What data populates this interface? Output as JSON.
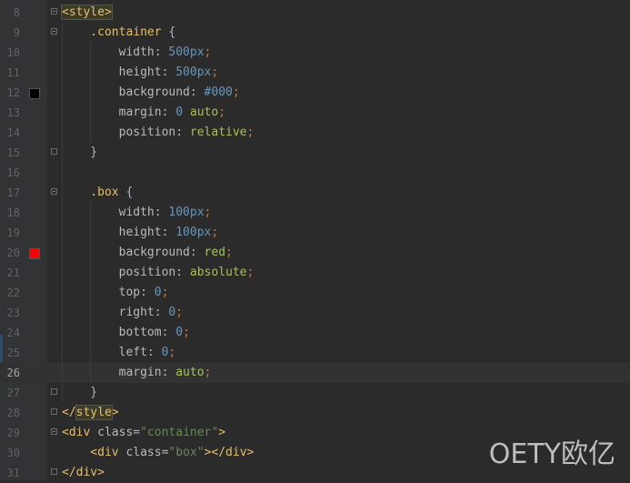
{
  "editor": {
    "lines": [
      {
        "n": "8",
        "tokens": [
          [
            "tag-hl",
            "<style>"
          ]
        ]
      },
      {
        "n": "9",
        "tokens": [
          [
            "sel",
            "    .container"
          ],
          [
            "brace",
            " {"
          ]
        ]
      },
      {
        "n": "10",
        "tokens": [
          [
            "prop",
            "        width"
          ],
          [
            "val",
            ": "
          ],
          [
            "num",
            "500px"
          ],
          [
            "punc",
            ";"
          ]
        ]
      },
      {
        "n": "11",
        "tokens": [
          [
            "prop",
            "        height"
          ],
          [
            "val",
            ": "
          ],
          [
            "num",
            "500px"
          ],
          [
            "punc",
            ";"
          ]
        ]
      },
      {
        "n": "12",
        "tokens": [
          [
            "prop",
            "        background"
          ],
          [
            "val",
            ": "
          ],
          [
            "num",
            "#000"
          ],
          [
            "punc",
            ";"
          ]
        ],
        "swatch": "#000000"
      },
      {
        "n": "13",
        "tokens": [
          [
            "prop",
            "        margin"
          ],
          [
            "val",
            ": "
          ],
          [
            "num",
            "0"
          ],
          [
            "val",
            " "
          ],
          [
            "kw",
            "auto"
          ],
          [
            "punc",
            ";"
          ]
        ]
      },
      {
        "n": "14",
        "tokens": [
          [
            "prop",
            "        position"
          ],
          [
            "val",
            ": "
          ],
          [
            "kw",
            "relative"
          ],
          [
            "punc",
            ";"
          ]
        ]
      },
      {
        "n": "15",
        "tokens": [
          [
            "brace",
            "    }"
          ]
        ]
      },
      {
        "n": "16",
        "tokens": []
      },
      {
        "n": "17",
        "tokens": [
          [
            "sel",
            "    .box"
          ],
          [
            "brace",
            " {"
          ]
        ]
      },
      {
        "n": "18",
        "tokens": [
          [
            "prop",
            "        width"
          ],
          [
            "val",
            ": "
          ],
          [
            "num",
            "100px"
          ],
          [
            "punc",
            ";"
          ]
        ]
      },
      {
        "n": "19",
        "tokens": [
          [
            "prop",
            "        height"
          ],
          [
            "val",
            ": "
          ],
          [
            "num",
            "100px"
          ],
          [
            "punc",
            ";"
          ]
        ]
      },
      {
        "n": "20",
        "tokens": [
          [
            "prop",
            "        background"
          ],
          [
            "val",
            ": "
          ],
          [
            "kw",
            "red"
          ],
          [
            "punc",
            ";"
          ]
        ],
        "swatch": "#ff0000"
      },
      {
        "n": "21",
        "tokens": [
          [
            "prop",
            "        position"
          ],
          [
            "val",
            ": "
          ],
          [
            "kw",
            "absolute"
          ],
          [
            "punc",
            ";"
          ]
        ]
      },
      {
        "n": "22",
        "tokens": [
          [
            "prop",
            "        top"
          ],
          [
            "val",
            ": "
          ],
          [
            "num",
            "0"
          ],
          [
            "punc",
            ";"
          ]
        ]
      },
      {
        "n": "23",
        "tokens": [
          [
            "prop",
            "        right"
          ],
          [
            "val",
            ": "
          ],
          [
            "num",
            "0"
          ],
          [
            "punc",
            ";"
          ]
        ]
      },
      {
        "n": "24",
        "tokens": [
          [
            "prop",
            "        bottom"
          ],
          [
            "val",
            ": "
          ],
          [
            "num",
            "0"
          ],
          [
            "punc",
            ";"
          ]
        ]
      },
      {
        "n": "25",
        "tokens": [
          [
            "prop",
            "        left"
          ],
          [
            "val",
            ": "
          ],
          [
            "num",
            "0"
          ],
          [
            "punc",
            ";"
          ]
        ]
      },
      {
        "n": "26",
        "tokens": [
          [
            "prop",
            "        margin"
          ],
          [
            "val",
            ": "
          ],
          [
            "kw",
            "auto"
          ],
          [
            "punc",
            ";"
          ]
        ],
        "current": true
      },
      {
        "n": "27",
        "tokens": [
          [
            "brace",
            "    }"
          ]
        ]
      },
      {
        "n": "28",
        "tokens": [
          [
            "tag",
            "</"
          ],
          [
            "tag-hl",
            "style"
          ],
          [
            "tag",
            ">"
          ]
        ]
      },
      {
        "n": "29",
        "tokens": [
          [
            "tag",
            "<div"
          ],
          [
            "attr",
            " class"
          ],
          [
            "val",
            "="
          ],
          [
            "str",
            "\"container\""
          ],
          [
            "tag",
            ">"
          ]
        ]
      },
      {
        "n": "30",
        "tokens": [
          [
            "tag",
            "    <div"
          ],
          [
            "attr",
            " class"
          ],
          [
            "val",
            "="
          ],
          [
            "str",
            "\"box\""
          ],
          [
            "tag",
            "></div>"
          ]
        ]
      },
      {
        "n": "31",
        "tokens": [
          [
            "tag",
            "</div>"
          ]
        ]
      }
    ],
    "folds": {
      "8": "open",
      "9": "open",
      "15": "close",
      "17": "open",
      "27": "close",
      "28": "close",
      "29": "open",
      "31": "close"
    }
  },
  "watermark": "OETY欧亿"
}
